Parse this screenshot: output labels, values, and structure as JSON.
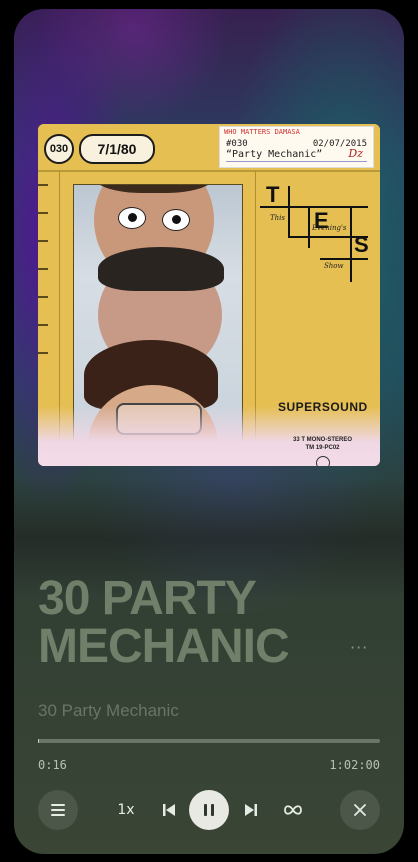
{
  "cover": {
    "number_badge": "030",
    "date_badge": "7/1/80",
    "ticket": {
      "header": "WHO MATTERS DAMASA",
      "code": "#030",
      "date": "02/07/2015",
      "quote": "“Party Mechanic”",
      "signature": "Dz"
    },
    "logo_words": {
      "this": "This",
      "evenings": "Evening's",
      "show": "Show",
      "t": "T",
      "e": "E",
      "s": "S"
    },
    "brand": "SUPERSOUND",
    "specs_line1": "33 T MONO-STEREO",
    "specs_line2": "TM 19-PC02"
  },
  "player": {
    "big_title": "30 PARTY MECHANIC",
    "more_label": "···",
    "subtitle": "30 Party Mechanic",
    "progress_fraction": 0.004,
    "elapsed": "0:16",
    "duration": "1:02:00",
    "speed_label": "1x"
  },
  "controls": {
    "queue_icon": "list-icon",
    "prev_icon": "skip-back-icon",
    "play_pause_icon": "pause-icon",
    "next_icon": "skip-forward-icon",
    "loop_icon": "infinity-icon",
    "close_icon": "close-icon"
  }
}
